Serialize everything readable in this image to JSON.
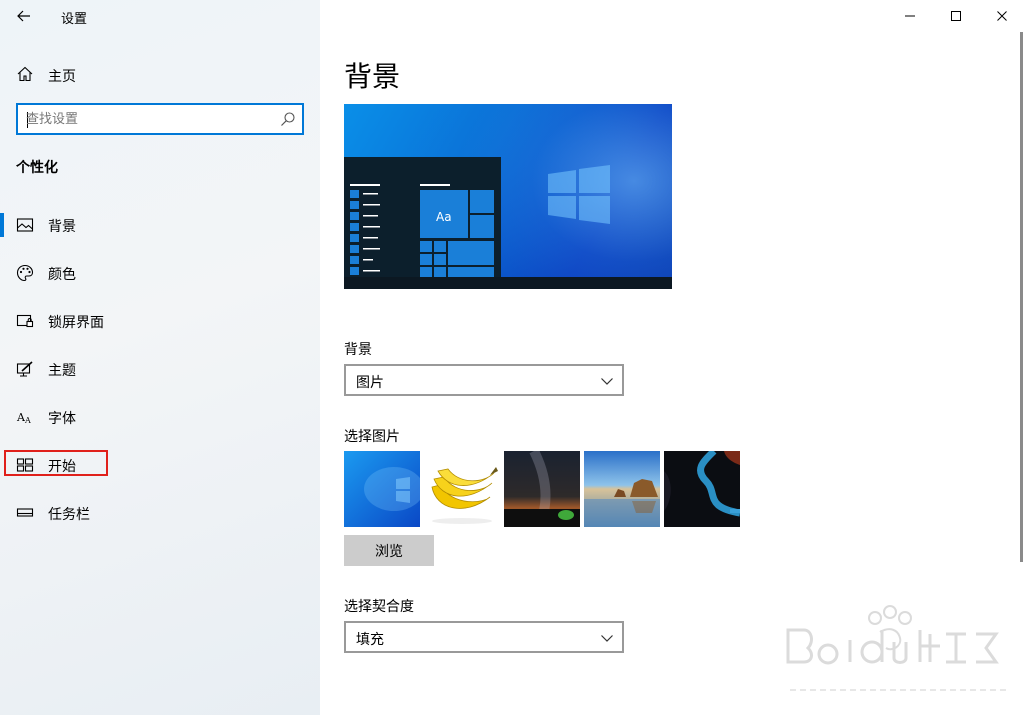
{
  "window": {
    "title": "设置"
  },
  "sidebar": {
    "home_label": "主页",
    "search_placeholder": "查找设置",
    "section_title": "个性化",
    "items": [
      {
        "label": "背景",
        "icon": "picture-icon",
        "active": true
      },
      {
        "label": "颜色",
        "icon": "palette-icon"
      },
      {
        "label": "锁屏界面",
        "icon": "lock-screen-icon"
      },
      {
        "label": "主题",
        "icon": "theme-icon"
      },
      {
        "label": "字体",
        "icon": "font-icon"
      },
      {
        "label": "开始",
        "icon": "start-icon",
        "highlighted": true
      },
      {
        "label": "任务栏",
        "icon": "taskbar-icon"
      }
    ]
  },
  "main": {
    "title": "背景",
    "preview": {
      "tile_text": "Aa"
    },
    "background": {
      "label": "背景",
      "value": "图片"
    },
    "choose_picture": {
      "label": "选择图片",
      "thumbnails": [
        "windows-blue",
        "bananas",
        "night-sky",
        "beach-rocks",
        "river-canyon"
      ]
    },
    "browse_label": "浏览",
    "fit": {
      "label": "选择契合度",
      "value": "填充"
    }
  },
  "colors": {
    "accent": "#0078d7",
    "highlight": "#e0201b"
  }
}
